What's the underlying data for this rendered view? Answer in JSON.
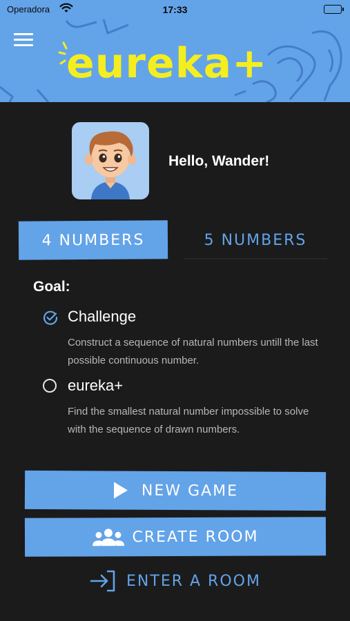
{
  "status_bar": {
    "carrier": "Operadora",
    "time": "17:33"
  },
  "header": {
    "logo": "eureka+",
    "logo_color": "#f4ee1f",
    "background": "#63a3e8"
  },
  "user": {
    "greeting": "Hello, Wander!"
  },
  "tabs": [
    {
      "label": "4 Numbers",
      "selected": true
    },
    {
      "label": "5 Numbers",
      "selected": false
    }
  ],
  "goal": {
    "title": "Goal:",
    "options": [
      {
        "label": "Challenge",
        "description": "Construct a sequence of natural numbers untill the last possible continuous number.",
        "selected": true
      },
      {
        "label": "eureka+",
        "description": "Find the smallest natural number impossible to solve with the sequence of drawn numbers.",
        "selected": false
      }
    ]
  },
  "actions": {
    "new_game": "New Game",
    "create_room": "Create Room",
    "enter_room": "Enter a Room"
  },
  "colors": {
    "accent": "#63a3e8",
    "background": "#1b1b1c"
  }
}
